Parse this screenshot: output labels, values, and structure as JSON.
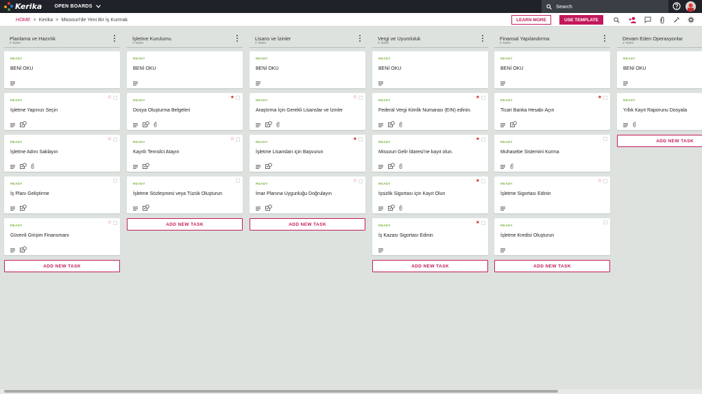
{
  "app": {
    "logo": "Kerika",
    "open_boards": "OPEN BOARDS"
  },
  "search": {
    "label": "Search"
  },
  "breadcrumb": {
    "home": "HOME",
    "org": "Kerika",
    "board": "Missouri'de Yeni Bir İş Kurmak"
  },
  "actions": {
    "learn_more": "LEARN MORE",
    "use_template": "USE TEMPLATE"
  },
  "colors": {
    "accent": "#c2185b",
    "ready": "#7cb342",
    "star": "#d32f2f",
    "topbar": "#1f2228"
  },
  "columns": [
    {
      "title": "Planlama ve Hazırlık",
      "count": "5 Tasks",
      "add": "ADD NEW TASK",
      "cards": [
        {
          "status": "READY",
          "title": "BENİ OKU",
          "icons": [
            "chat"
          ],
          "star": ""
        },
        {
          "status": "READY",
          "title": "İşletme Yapınızı Seçin",
          "icons": [
            "chat",
            "tasks"
          ],
          "star": "outline"
        },
        {
          "status": "READY",
          "title": "İşletme Adını Saklayın",
          "icons": [
            "chat",
            "tasks",
            "attach"
          ],
          "star": "outline"
        },
        {
          "status": "READY",
          "title": "İş Planı Geliştirme",
          "icons": [
            "chat",
            "tasks"
          ],
          "star": "none"
        },
        {
          "status": "READY",
          "title": "Güvenli Girişim Finansmanı",
          "icons": [
            "chat",
            "tasks"
          ],
          "star": "outline"
        }
      ]
    },
    {
      "title": "İşletme Kurulumu",
      "count": "4 Tasks",
      "add": "ADD NEW TASK",
      "cards": [
        {
          "status": "READY",
          "title": "BENİ OKU",
          "icons": [
            "chat"
          ],
          "star": ""
        },
        {
          "status": "READY",
          "title": "Dosya Oluşturma Belgeleri",
          "icons": [
            "chat",
            "tasks",
            "attach"
          ],
          "star": "filled"
        },
        {
          "status": "READY",
          "title": "Kayıtlı Temsilci Atayın",
          "icons": [
            "chat",
            "tasks"
          ],
          "star": "outline"
        },
        {
          "status": "READY",
          "title": "İşletme Sözleşmesi veya Tüzük Oluşturun",
          "icons": [
            "chat",
            "tasks"
          ],
          "star": "none"
        }
      ]
    },
    {
      "title": "Lisans ve İzinler",
      "count": "4 Tasks",
      "add": "ADD NEW TASK",
      "cards": [
        {
          "status": "READY",
          "title": "BENİ OKU",
          "icons": [
            "chat"
          ],
          "star": ""
        },
        {
          "status": "READY",
          "title": "Araştırma İçin Gerekli Lisanslar ve İzinler",
          "icons": [
            "chat",
            "tasks",
            "attach"
          ],
          "star": "outline"
        },
        {
          "status": "READY",
          "title": "İşletme Lisansları için Başvurun",
          "icons": [
            "chat",
            "tasks"
          ],
          "star": "filled"
        },
        {
          "status": "READY",
          "title": "İmar Planına Uygunluğu Doğrulayın",
          "icons": [
            "chat",
            "tasks"
          ],
          "star": "outline"
        }
      ]
    },
    {
      "title": "Vergi ve Uyumluluk",
      "count": "5 Tasks",
      "add": "ADD NEW TASK",
      "cards": [
        {
          "status": "READY",
          "title": "BENİ OKU",
          "icons": [
            "chat"
          ],
          "star": ""
        },
        {
          "status": "READY",
          "title": "Federal Vergi Kimlik Numarası (EIN) edinin.",
          "icons": [
            "chat",
            "tasks",
            "attach"
          ],
          "star": "filled"
        },
        {
          "status": "READY",
          "title": "Missouri Gelir İdaresi'ne kayıt olun.",
          "icons": [
            "chat",
            "tasks",
            "attach"
          ],
          "star": "filled"
        },
        {
          "status": "READY",
          "title": "İşsizlik Sigortası için Kayıt Olun",
          "icons": [
            "chat",
            "tasks",
            "attach"
          ],
          "star": "filled"
        },
        {
          "status": "READY",
          "title": "İş Kazası Sigortası Edinin",
          "icons": [
            "chat"
          ],
          "star": "filled"
        }
      ]
    },
    {
      "title": "Finansal Yapılandırma",
      "count": "5 Tasks",
      "add": "ADD NEW TASK",
      "cards": [
        {
          "status": "READY",
          "title": "BENİ OKU",
          "icons": [
            "chat"
          ],
          "star": ""
        },
        {
          "status": "READY",
          "title": "Ticari Banka Hesabı Açın",
          "icons": [
            "chat",
            "tasks"
          ],
          "star": "filled"
        },
        {
          "status": "READY",
          "title": "Muhasebe Sistemini Kurma",
          "icons": [
            "chat",
            "attach"
          ],
          "star": "none"
        },
        {
          "status": "READY",
          "title": "İşletme Sigortası Edinin",
          "icons": [
            "chat"
          ],
          "star": "outline"
        },
        {
          "status": "READY",
          "title": "İşletme Kredisi Oluşturun",
          "icons": [
            "chat"
          ],
          "star": "none"
        }
      ]
    },
    {
      "title": "Devam Eden Operasyonlar",
      "count": "2 Tasks",
      "add": "ADD NEW TASK",
      "cards": [
        {
          "status": "READY",
          "title": "BENİ OKU",
          "icons": [
            "chat"
          ],
          "star": ""
        },
        {
          "status": "READY",
          "title": "Yıllık Kayıt Raporunu Dosyala",
          "icons": [
            "chat",
            "attach"
          ],
          "star": "none"
        }
      ]
    }
  ]
}
